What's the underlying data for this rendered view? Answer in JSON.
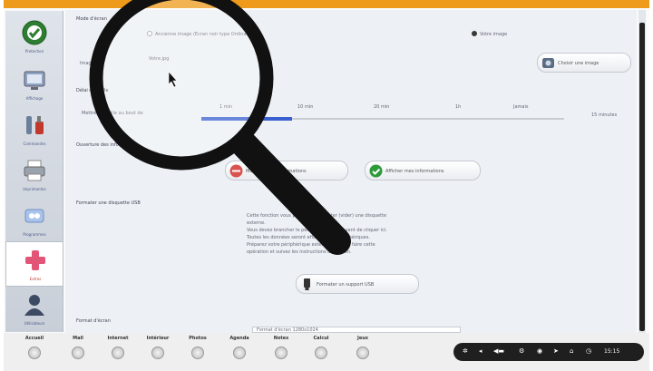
{
  "sidebar": {
    "items": [
      {
        "label": "Protection",
        "icon": "shield-check-icon"
      },
      {
        "label": "Affichage",
        "icon": "display-icon"
      },
      {
        "label": "Commandes",
        "icon": "tools-icon"
      },
      {
        "label": "Imprimantes",
        "icon": "printer-icon"
      },
      {
        "label": "Programmes",
        "icon": "windows-icon"
      },
      {
        "label": "Extras",
        "icon": "plus-icon"
      },
      {
        "label": "Utilisateurs",
        "icon": "user-icon"
      }
    ],
    "active_index": 5
  },
  "main": {
    "mode_section_label": "Mode d'écran",
    "radio_image_label": "Ancienne image (Ecran noir type Ordinateur)",
    "radio_image_right_label": "Votre image",
    "file_label": "Image",
    "file_value": "Votre.jpg",
    "choose_image_button": "Choisir une image",
    "delay_section_label": "Délai de veille",
    "delay_row_label": "Mettre en veille au bout de",
    "delay_ticks": [
      "1 min",
      "10 min",
      "20 min",
      "1h",
      "Jamais",
      "15 minutes"
    ],
    "delay_value_fraction": 0.25,
    "info_section_label": "Ouverture des informations",
    "hide_info_button": "Masquer mes informations",
    "show_info_button": "Afficher mes informations",
    "usb_section_label": "Formater une disquette USB",
    "usb_description": [
      "Cette fonction vous permet de formater (vider) une disquette",
      "externe.",
      "Vous devez brancher le périphérique USB avant de cliquer ici.",
      "Toutes les données seront effacées des périphériques.",
      "Préparez votre périphérique externe avant de faire cette",
      "opération et suivez les instructions de l'écran."
    ],
    "usb_button": "Formater un support USB",
    "format_section_label": "Format d'écran",
    "format_select_value": "Format d'écran 1280x1024"
  },
  "taskbar": {
    "items": [
      "Accueil",
      "Mail",
      "Internet",
      "Intérieur",
      "Photos",
      "Agenda",
      "Notes",
      "Calcul",
      "Jeux"
    ],
    "clock": "15:15"
  }
}
